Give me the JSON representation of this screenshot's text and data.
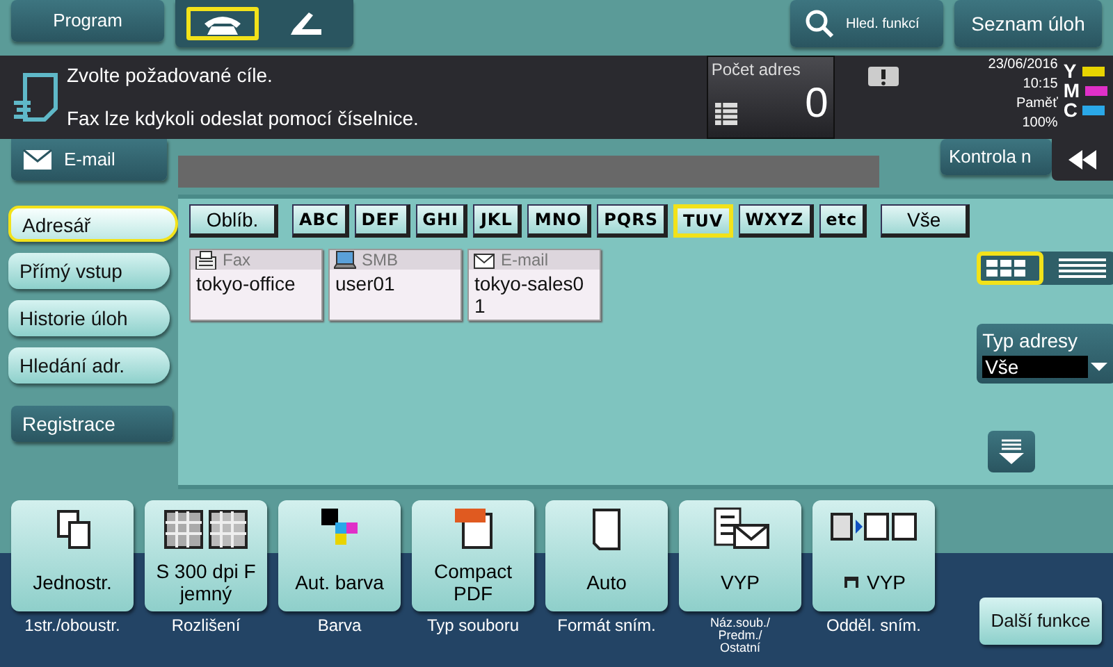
{
  "top_bar": {
    "program_button": "Program",
    "modes": [
      {
        "kind": "phone",
        "selected": true
      },
      {
        "kind": "handset",
        "selected": false
      }
    ],
    "search_button": "Hled. funkcí",
    "jobs_button": "Seznam úloh"
  },
  "message": {
    "lines": [
      "Zvolte požadované cíle.",
      "Fax lze kdykoli odeslat pomocí číselnice."
    ],
    "count_label": "Počet adres",
    "count": "0",
    "date": "23/06/2016",
    "time": "10:15",
    "memory_label": "Paměť",
    "memory": "100%",
    "toner": [
      {
        "label": "Y",
        "color": "#e8d400"
      },
      {
        "label": "M",
        "color": "#e030c8"
      },
      {
        "label": "C",
        "color": "#2aa8e8"
      }
    ]
  },
  "email_tab": "E-mail",
  "check_button": "Kontrola n",
  "sidebar": [
    {
      "label": "Adresář",
      "selected": true
    },
    {
      "label": "Přímý vstup",
      "selected": false
    },
    {
      "label": "Historie úloh",
      "selected": false
    },
    {
      "label": "Hledání adr.",
      "selected": false
    }
  ],
  "register_button": "Registrace",
  "index_tabs": [
    {
      "label": "Oblíb.",
      "kind": "plain",
      "selected": false
    },
    {
      "label": "ABC",
      "kind": "letters",
      "selected": false
    },
    {
      "label": "DEF",
      "kind": "letters",
      "selected": false
    },
    {
      "label": "GHI",
      "kind": "letters",
      "selected": false
    },
    {
      "label": "JKL",
      "kind": "letters",
      "selected": false
    },
    {
      "label": "MNO",
      "kind": "letters",
      "selected": false
    },
    {
      "label": "PQRS",
      "kind": "letters",
      "selected": false
    },
    {
      "label": "TUV",
      "kind": "letters",
      "selected": true
    },
    {
      "label": "WXYZ",
      "kind": "letters",
      "selected": false
    },
    {
      "label": "etc",
      "kind": "letters",
      "selected": false
    },
    {
      "label": "Vše",
      "kind": "plain",
      "selected": false
    }
  ],
  "addresses": [
    {
      "kind": "fax",
      "type": "Fax",
      "name": "tokyo-office"
    },
    {
      "kind": "smb",
      "type": "SMB",
      "name": "user01"
    },
    {
      "kind": "email",
      "type": "E-mail",
      "name": "tokyo-sales01"
    }
  ],
  "view_modes": [
    {
      "kind": "grid",
      "selected": true
    },
    {
      "kind": "list",
      "selected": false
    }
  ],
  "address_type": {
    "label": "Typ adresy",
    "value": "Vše"
  },
  "functions": [
    {
      "kind": "duplex",
      "value": "Jednostr.",
      "caption": "1str./oboustr."
    },
    {
      "kind": "resolution",
      "value": "S 300 dpi F jemný",
      "caption": "Rozlišení"
    },
    {
      "kind": "color",
      "value": "Aut. barva",
      "caption": "Barva"
    },
    {
      "kind": "pdf",
      "value": "Compact PDF",
      "caption": "Typ souboru"
    },
    {
      "kind": "page",
      "value": "Auto",
      "caption": "Formát sním."
    },
    {
      "kind": "filename",
      "value": "VYP",
      "caption": "Náz.soub./ Predm./ Ostatní"
    },
    {
      "kind": "separate",
      "value": "VYP",
      "caption": "Odděl. sním."
    }
  ],
  "more_button": "Další funkce"
}
